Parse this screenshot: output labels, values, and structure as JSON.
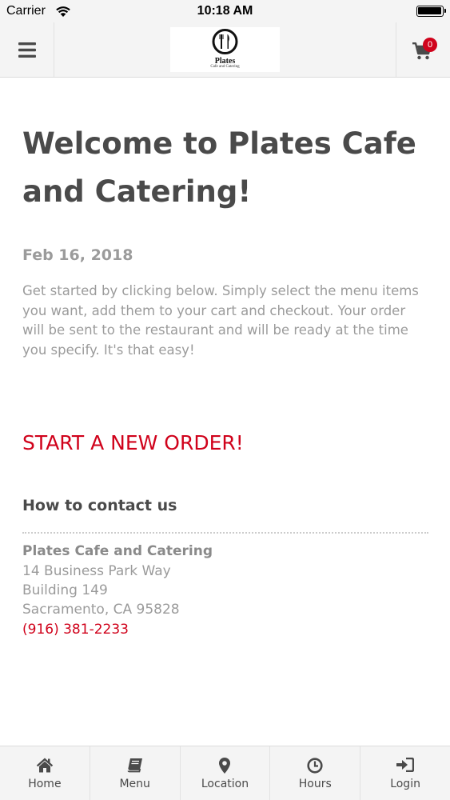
{
  "status_bar": {
    "carrier": "Carrier",
    "time": "10:18 AM",
    "battery_level": 1.0
  },
  "header": {
    "menu_icon": "hamburger-menu-icon",
    "logo_title": "Plates",
    "logo_subtitle": "Cafe and Catering",
    "cart_icon": "shopping-cart-icon",
    "cart_count": "0"
  },
  "main": {
    "title": "Welcome to Plates Cafe and Catering!",
    "date": "Feb 16, 2018",
    "intro": "Get started by clicking below. Simply select the menu items you want, add them to your cart and checkout. Your order will be sent to the restaurant and will be ready at the time you specify. It's that easy!",
    "start_order_label": "START A NEW ORDER!"
  },
  "contact": {
    "heading": "How to contact us",
    "name": "Plates Cafe and Catering",
    "address_line1": "14 Business Park Way",
    "address_line2": "Building 149",
    "address_line3": "Sacramento, CA 95828",
    "phone": "(916) 381-2233"
  },
  "tabs": [
    {
      "label": "Home",
      "icon": "home-icon"
    },
    {
      "label": "Menu",
      "icon": "book-icon"
    },
    {
      "label": "Location",
      "icon": "map-pin-icon"
    },
    {
      "label": "Hours",
      "icon": "clock-icon"
    },
    {
      "label": "Login",
      "icon": "sign-in-icon"
    }
  ],
  "colors": {
    "accent": "#d0021b",
    "text_dark": "#4a4a4a",
    "text_muted": "#9b9b9b",
    "bar_background": "#f4f4f4"
  }
}
